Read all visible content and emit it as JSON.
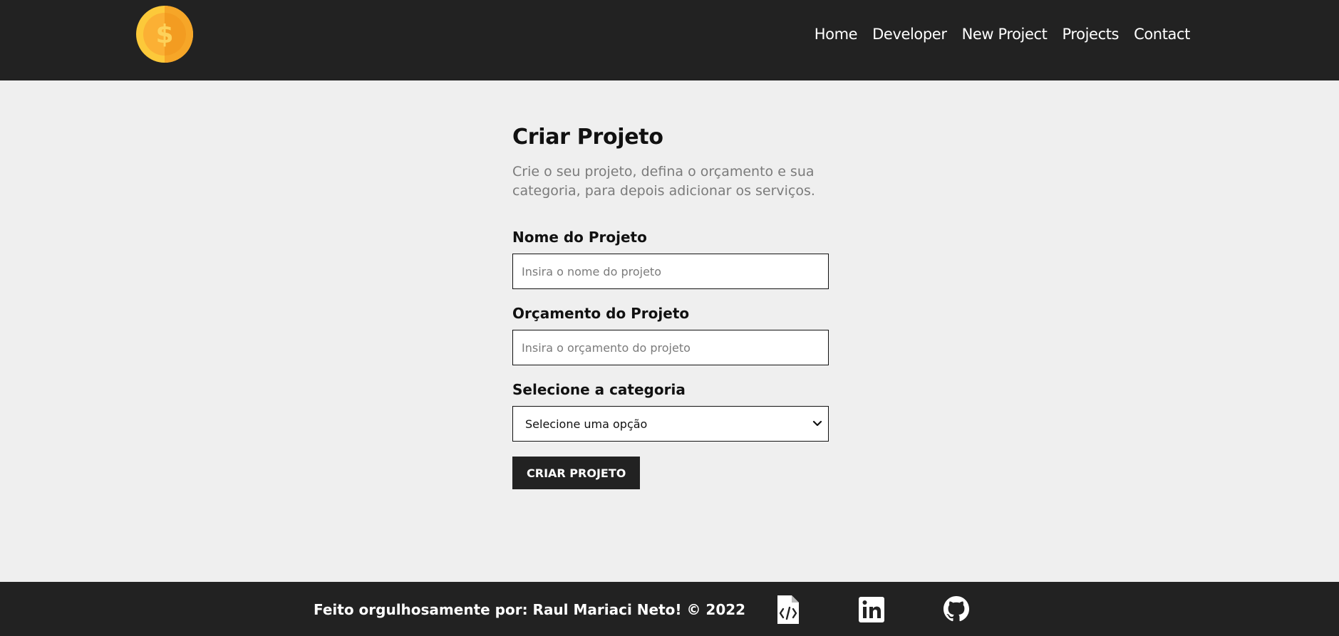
{
  "navbar": {
    "logo_icon": "dollar-coin-icon",
    "links": [
      "Home",
      "Developer",
      "New Project",
      "Projects",
      "Contact"
    ]
  },
  "form": {
    "title": "Criar Projeto",
    "subtitle": "Crie o seu projeto, defina o orçamento e sua categoria, para depois adicionar os serviços.",
    "name_label": "Nome do Projeto",
    "name_placeholder": "Insira o nome do projeto",
    "budget_label": "Orçamento do Projeto",
    "budget_placeholder": "Insira o orçamento do projeto",
    "category_label": "Selecione a categoria",
    "category_selected": "Selecione uma opção",
    "submit_label": "CRIAR PROJETO"
  },
  "footer": {
    "text": "Feito orgulhosamente por: Raul Mariaci Neto! © 2022",
    "icons": [
      "code-file-icon",
      "linkedin-icon",
      "github-icon"
    ]
  },
  "colors": {
    "dark": "#222222",
    "background": "#efefef",
    "coin_outer": "#fdb92e",
    "coin_inner": "#f6a628"
  }
}
